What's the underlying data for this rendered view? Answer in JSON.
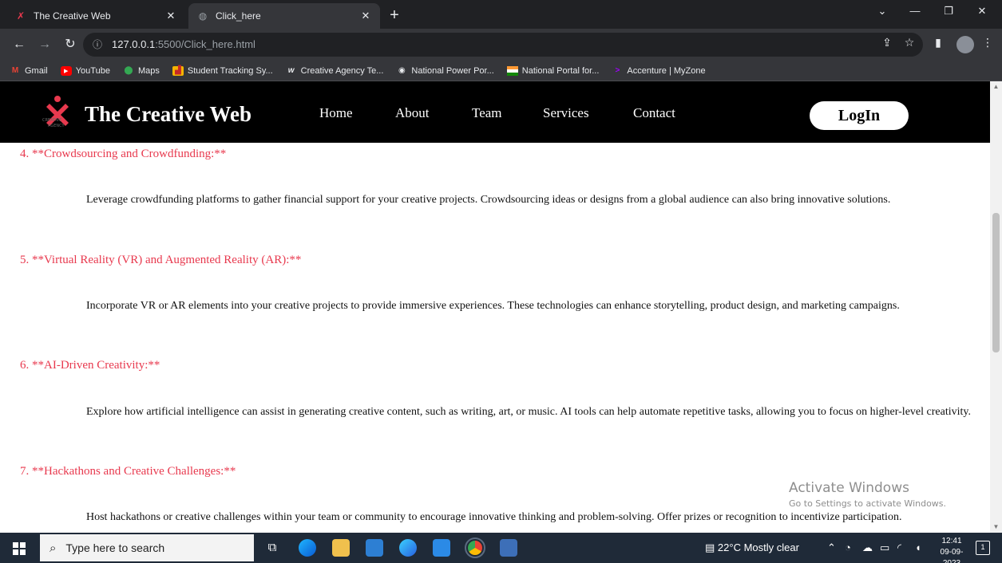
{
  "browser": {
    "tabs": [
      {
        "title": "The Creative Web",
        "active": false
      },
      {
        "title": "Click_here",
        "active": true
      }
    ],
    "new_tab": "+",
    "window_controls": [
      "⌄",
      "—",
      "❐",
      "✕"
    ],
    "url_host": "127.0.0.1",
    "url_path": ":5500/Click_here.html",
    "bookmarks": [
      {
        "label": "Gmail",
        "icon": "gmail-icon",
        "color": "#ea4335"
      },
      {
        "label": "YouTube",
        "icon": "youtube-icon",
        "color": "#ff0000"
      },
      {
        "label": "Maps",
        "icon": "maps-icon",
        "color": "#34a853"
      },
      {
        "label": "Student Tracking Sy...",
        "icon": "chart-icon",
        "color": "#f4b400"
      },
      {
        "label": "Creative Agency Te...",
        "icon": "w-icon",
        "color": "#ffffff"
      },
      {
        "label": "National Power Por...",
        "icon": "globe-icon",
        "color": "#e8eaed"
      },
      {
        "label": "National Portal for...",
        "icon": "flag-icon",
        "color": "#ff9933"
      },
      {
        "label": "Accenture | MyZone",
        "icon": "accenture-icon",
        "color": "#a100ff"
      }
    ]
  },
  "site": {
    "brand": "The Creative Web",
    "nav": [
      "Home",
      "About",
      "Team",
      "Services",
      "Contact"
    ],
    "login": "LogIn",
    "accent": "#e8394e"
  },
  "sections": [
    {
      "heading": "4. **Crowdsourcing and Crowdfunding:**",
      "text": "Leverage crowdfunding platforms to gather financial support for your creative projects. Crowdsourcing ideas or designs from a global audience can also bring innovative solutions."
    },
    {
      "heading": "5. **Virtual Reality (VR) and Augmented Reality (AR):**",
      "text": "Incorporate VR or AR elements into your creative projects to provide immersive experiences. These technologies can enhance storytelling, product design, and marketing campaigns."
    },
    {
      "heading": "6. **AI-Driven Creativity:**",
      "text": "Explore how artificial intelligence can assist in generating creative content, such as writing, art, or music. AI tools can help automate repetitive tasks, allowing you to focus on higher-level creativity."
    },
    {
      "heading": "7. **Hackathons and Creative Challenges:**",
      "text": "Host hackathons or creative challenges within your team or community to encourage innovative thinking and problem-solving. Offer prizes or recognition to incentivize participation."
    }
  ],
  "watermark": {
    "title": "Activate Windows",
    "subtitle": "Go to Settings to activate Windows."
  },
  "taskbar": {
    "search_placeholder": "Type here to search",
    "weather": "22°C  Mostly clear",
    "time": "12:41",
    "date": "09-09-2023",
    "notification_count": "1"
  }
}
